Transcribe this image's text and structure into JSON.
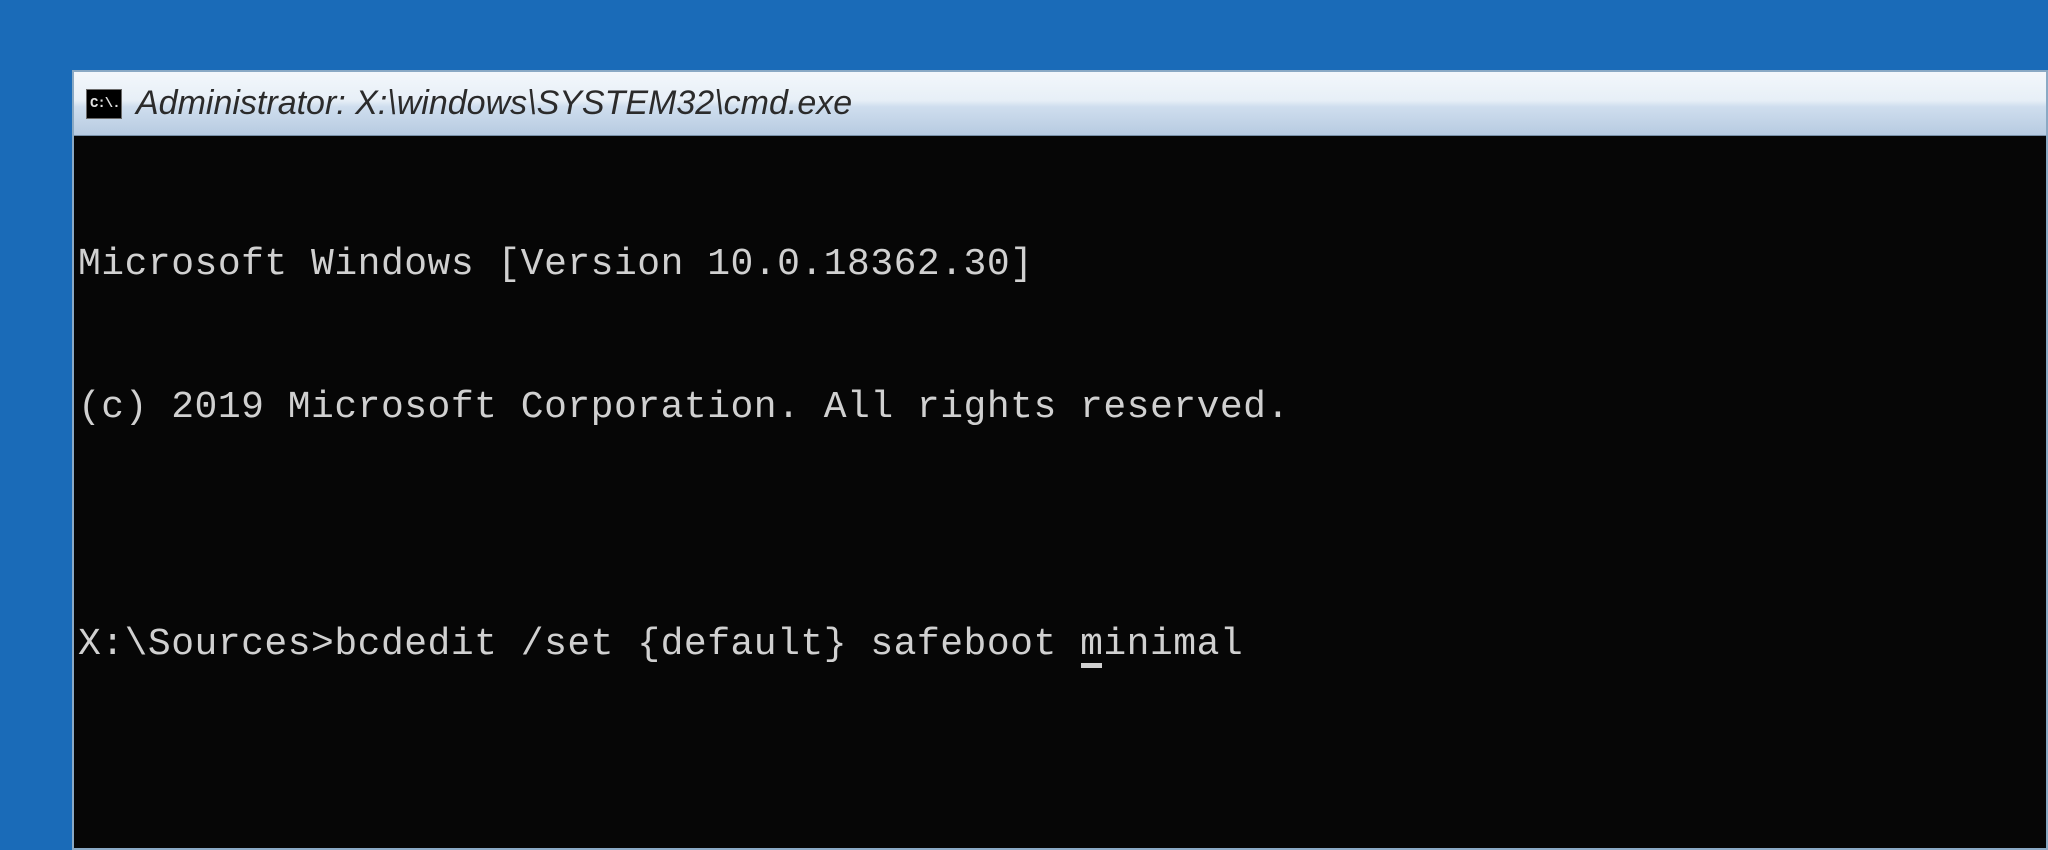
{
  "window": {
    "title": "Administrator: X:\\windows\\SYSTEM32\\cmd.exe",
    "icon_glyph": "C:\\."
  },
  "terminal": {
    "banner_line1": "Microsoft Windows [Version 10.0.18362.30]",
    "banner_line2": "(c) 2019 Microsoft Corporation. All rights reserved.",
    "blank": "",
    "prompt": "X:\\Sources>",
    "command_before_cursor": "bcdedit /set {default} safeboot ",
    "cursor_char": "m",
    "command_after_cursor": "inimal"
  }
}
